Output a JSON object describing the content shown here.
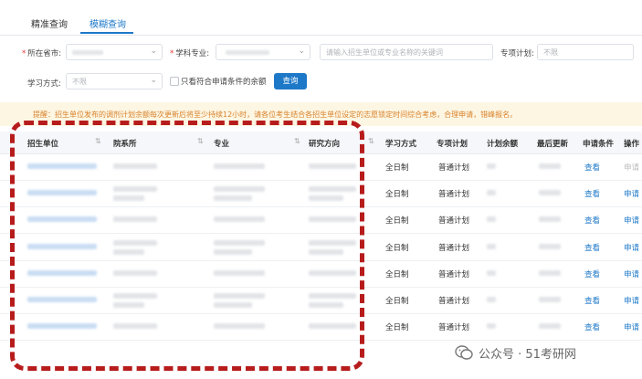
{
  "tabs": [
    {
      "label": "精准查询"
    },
    {
      "label": "模糊查询"
    }
  ],
  "form": {
    "province_label": "所在省市:",
    "subject_label": "学科专业:",
    "keyword_placeholder": "请输入招生单位或专业名称的关键词",
    "plan_label": "专项计划:",
    "plan_value": "不限",
    "mode_label": "学习方式:",
    "mode_value": "不限",
    "only_eligible_label": "只看符合申请条件的余额",
    "query_button": "查询"
  },
  "notice": "提醒：招生单位发布的调剂计划余额每次更新后将至少持续12小时，请各位考生结合各招生单位设定的志愿锁定时间综合考虑，合理申请，错峰报名。",
  "table": {
    "headers": [
      "招生单位",
      "院系所",
      "专业",
      "研究方向",
      "学习方式",
      "专项计划",
      "计划余额",
      "最后更新",
      "申请条件",
      "操作"
    ],
    "rows": [
      {
        "mode": "全日制",
        "plan": "普通计划",
        "cond": "查看",
        "op": "申请",
        "op_enabled": false
      },
      {
        "mode": "全日制",
        "plan": "普通计划",
        "cond": "查看",
        "op": "申请",
        "op_enabled": true
      },
      {
        "mode": "全日制",
        "plan": "普通计划",
        "cond": "查看",
        "op": "申请",
        "op_enabled": true
      },
      {
        "mode": "全日制",
        "plan": "普通计划",
        "cond": "查看",
        "op": "申请",
        "op_enabled": true
      },
      {
        "mode": "全日制",
        "plan": "普通计划",
        "cond": "查看",
        "op": "申请",
        "op_enabled": true
      },
      {
        "mode": "全日制",
        "plan": "普通计划",
        "cond": "查看",
        "op": "申请",
        "op_enabled": true
      },
      {
        "mode": "全日制",
        "plan": "普通计划",
        "cond": "查看",
        "op": "申请",
        "op_enabled": true
      }
    ]
  },
  "watermark": "公众号 · 51考研网",
  "colors": {
    "accent": "#1e78c8",
    "notice_text": "#d9822b",
    "highlight": "#b71c1c"
  }
}
